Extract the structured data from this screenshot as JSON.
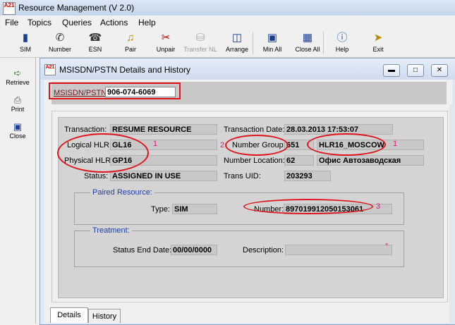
{
  "app": {
    "title": "Resource Management  (V 2.0)",
    "icon_text": "A21"
  },
  "menu": [
    "File",
    "Topics",
    "Queries",
    "Actions",
    "Help"
  ],
  "toolbar": {
    "sim": "SIM",
    "number": "Number",
    "esn": "ESN",
    "pair": "Pair",
    "unpair": "Unpair",
    "transfer": "Transfer NL",
    "arrange": "Arrange",
    "min_all": "Min All",
    "close_all": "Close All",
    "help": "Help",
    "exit": "Exit"
  },
  "leftbar": {
    "retrieve": "Retrieve",
    "print": "Print",
    "close": "Close"
  },
  "child": {
    "title": "MSISDN/PSTN Details and History",
    "msisdn_label": "MSISDN/PSTN:",
    "msisdn_value": "906-074-6069"
  },
  "details": {
    "transaction_label": "Transaction:",
    "transaction_value": "RESUME RESOURCE",
    "transaction_date_label": "Transaction Date:",
    "transaction_date_value": "28.03.2013 17:53:07",
    "logical_hlr_label": "Logical HLR:",
    "logical_hlr_value": "GL16",
    "number_group_label": "Number Group:",
    "number_group_value": "651",
    "number_group_name": "HLR16_MOSCOW",
    "physical_hlr_label": "Physical HLR:",
    "physical_hlr_value": "GP16",
    "number_location_label": "Number Location:",
    "number_location_value": "62",
    "number_location_name": "Офис Автозаводская",
    "status_label": "Status:",
    "status_value": "ASSIGNED IN USE",
    "trans_uid_label": "Trans UID:",
    "trans_uid_value": "203293",
    "paired_title": "Paired Resource:",
    "type_label": "Type:",
    "type_value": "SIM",
    "paired_number_label": "Number:",
    "paired_number_value": "89701991205015306​1",
    "treatment_title": "Treatment:",
    "status_end_label": "Status End Date:",
    "status_end_value": "00/00/0000",
    "description_label": "Description:",
    "description_value": "",
    "description_mark": "°"
  },
  "annotations": {
    "one_a": "1",
    "two": "2",
    "one_b": "1",
    "three": "3"
  },
  "tabs": [
    "Details",
    "History"
  ],
  "colors": {
    "highlight": "#e0131b",
    "annotation_number": "#e0137a",
    "group_title": "#1f3f9f"
  }
}
